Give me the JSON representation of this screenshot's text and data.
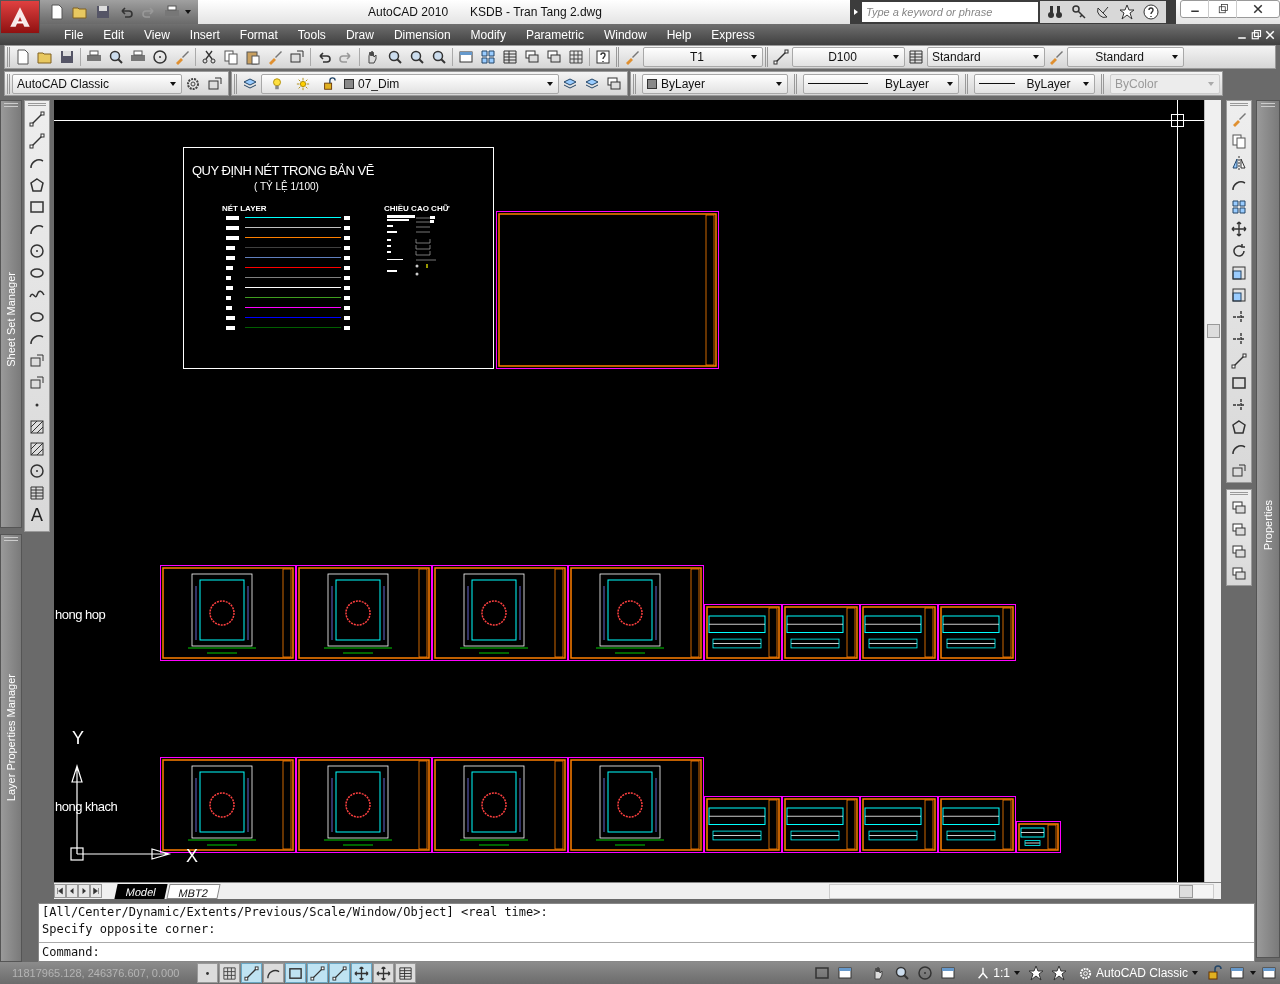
{
  "title_bar": {
    "app": "AutoCAD 2010",
    "document": "KSDB - Tran Tang 2.dwg",
    "search_placeholder": "Type a keyword or phrase"
  },
  "menu": [
    {
      "label": "File"
    },
    {
      "label": "Edit"
    },
    {
      "label": "View"
    },
    {
      "label": "Insert"
    },
    {
      "label": "Format"
    },
    {
      "label": "Tools"
    },
    {
      "label": "Draw"
    },
    {
      "label": "Dimension"
    },
    {
      "label": "Modify"
    },
    {
      "label": "Parametric"
    },
    {
      "label": "Window"
    },
    {
      "label": "Help"
    },
    {
      "label": "Express"
    }
  ],
  "toolbars": {
    "text_style": "T1",
    "dim_style": "D100",
    "table_style": "Standard",
    "multileader_style": "Standard",
    "workspace": "AutoCAD Classic",
    "layer": "07_Dim",
    "color_control": "ByLayer",
    "linetype": "ByLayer",
    "lineweight": "ByLayer",
    "plot_style": {
      "value": "ByColor",
      "disabled": true
    }
  },
  "palettes": {
    "left_top": "Sheet Set Manager",
    "left_bottom": "Layer Properties Manager",
    "right": "Properties"
  },
  "draw_toolbar": {
    "mtext_glyph": "A"
  },
  "drawing": {
    "title": "QUY ĐỊNH NÉT TRONG BẢN VẼ",
    "scale": "( TỶ LỆ 1/100)",
    "legend_heading": "NÉT LAYER",
    "text_height_heading": "CHIỀU CAO CHỮ",
    "legend_lines": [
      {
        "color": "#00ffff"
      },
      {
        "color": "#c0c0c0"
      },
      {
        "color": "#ff7f00"
      },
      {
        "color": "#404040"
      },
      {
        "color": "#5f7fbf"
      },
      {
        "color": "#ff0000"
      },
      {
        "color": "#808080"
      },
      {
        "color": "#ffffff"
      },
      {
        "color": "#3f9f1f"
      },
      {
        "color": "#ff00ff"
      },
      {
        "color": "#0000ff"
      },
      {
        "color": "#005f00"
      }
    ],
    "rows": [
      {
        "label": "hong hop",
        "sheets": [
          {
            "kind": "large"
          },
          {
            "kind": "large"
          },
          {
            "kind": "large"
          },
          {
            "kind": "large"
          },
          {
            "kind": "small"
          },
          {
            "kind": "small"
          },
          {
            "kind": "small"
          },
          {
            "kind": "small"
          }
        ]
      },
      {
        "label": "hong khach",
        "sheets": [
          {
            "kind": "large"
          },
          {
            "kind": "large"
          },
          {
            "kind": "large"
          },
          {
            "kind": "large"
          },
          {
            "kind": "small"
          },
          {
            "kind": "small"
          },
          {
            "kind": "small"
          },
          {
            "kind": "small"
          },
          {
            "kind": "tiny"
          }
        ]
      }
    ],
    "ucs": {
      "y": "Y",
      "x": "X"
    }
  },
  "layout_tabs": [
    {
      "label": "Model",
      "selected": true
    },
    {
      "label": "MBT2",
      "selected": false
    }
  ],
  "command": {
    "history": [
      "[All/Center/Dynamic/Extents/Previous/Scale/Window/Object] <real time>:",
      "Specify opposite corner:"
    ],
    "prompt": "Command:"
  },
  "status_bar": {
    "coordinates": "11817965.128, 246376.607, 0.000",
    "coordinates_disabled": true,
    "toggles": [
      {
        "on": false
      },
      {
        "on": false
      },
      {
        "on": true
      },
      {
        "on": false
      },
      {
        "on": true
      },
      {
        "on": true
      },
      {
        "on": true
      },
      {
        "on": true
      },
      {
        "on": false
      },
      {
        "on": false
      }
    ],
    "annotation_scale": "1:1",
    "workspace": "AutoCAD Classic"
  }
}
